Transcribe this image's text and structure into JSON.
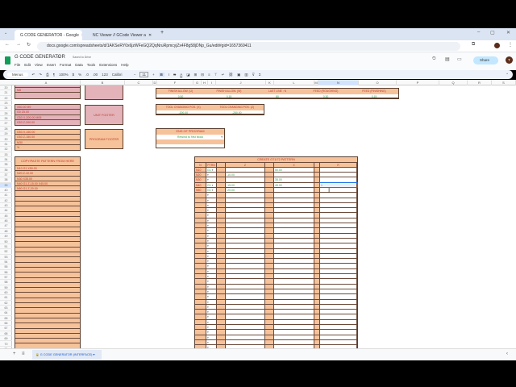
{
  "browser": {
    "tabs": [
      {
        "label": "G CODE GENERATOR - Google",
        "active": true
      },
      {
        "label": "NC Viewer // GCode Viewer a",
        "active": false
      }
    ],
    "new_tab": "+",
    "url": "docs.google.com/spreadsheets/d/1AKSeRY0x6jzWFeGQ2QqNruRpmcyjZx4F8g58jDNp_Gu/edit#gid=1657369411"
  },
  "sheets": {
    "title": "G CODE GENERATOR",
    "saved": "Saved to Drive",
    "menus": [
      "File",
      "Edit",
      "View",
      "Insert",
      "Format",
      "Data",
      "Tools",
      "Extensions",
      "Help"
    ],
    "share": "Share",
    "avatar": "T",
    "accent": "#c2e7ff"
  },
  "toolbar": {
    "menus": "Menus",
    "zoom": "100%",
    "currency": "$",
    "percent": "%",
    "dec_less": ".0",
    "dec_more": ".00",
    "format": "123",
    "font": "Calibri",
    "font_size": "11",
    "bold": "B",
    "italic": "I",
    "strike": "S",
    "text_color": "A"
  },
  "columns": [
    "A",
    "B",
    "C",
    "D",
    "E",
    "F",
    "G",
    "H",
    "I",
    "J",
    "K",
    "L",
    "M",
    "N",
    "O",
    "P",
    "Q",
    "R",
    "S"
  ],
  "rows": [
    20,
    21,
    22,
    23,
    24,
    25,
    26,
    27,
    28,
    29,
    30,
    31,
    32,
    33,
    34,
    35,
    36,
    37,
    38,
    39,
    40,
    41,
    42,
    43,
    44,
    45,
    46,
    47,
    48,
    49,
    50,
    51,
    52,
    53,
    54,
    55,
    56,
    57,
    58,
    59,
    60,
    61,
    62,
    63,
    64,
    65,
    66,
    67,
    68,
    69,
    70,
    71
  ],
  "blocks": {
    "unit_header_tail": [
      "",
      "M8",
      ""
    ],
    "unit_footer": {
      "lines": [
        "X50.00 M9",
        "G0 Z5.00",
        "G53 X-200.00 M05",
        "G53 Z-200.00"
      ],
      "label": "UNIT FOOTER"
    },
    "program_footer": {
      "lines": [
        "G53 X-150.00",
        "G53 Z-150.00",
        "M30",
        "%"
      ],
      "label": "PROGRAM FOOTER"
    },
    "copy_paste": {
      "header": "COPY/PASTE PATTERN FROM HERE",
      "lines": [
        "N10 G1 X50.00",
        "N20 Z-10.00",
        "N30 X35.00",
        "N40 G1 Z-15.00 X45.00",
        "N50 G1 Z-20.00"
      ]
    }
  },
  "params": {
    "headers": [
      "FINISH ALLOW. (U)",
      "FINISH ALLOW. (W)",
      "LAST LINE : N",
      "FEED (ROUGHING)",
      "FEED (FINISHING)"
    ],
    "values": [
      "0.50",
      "0.15",
      "80",
      "0.30",
      "0.15"
    ]
  },
  "tool_pos": {
    "headers": [
      "TOOL CHANGING POS. (X)",
      "TOOL CHANGING POS. (Z)"
    ],
    "values": [
      "-200.00",
      "-250.00"
    ]
  },
  "end_program": {
    "header": "END OF PROGRAM",
    "value": "Rewind to first block"
  },
  "pattern": {
    "title": "CREATE G71/72 PATTERN",
    "headers": [
      "N",
      "PTRN",
      "Z",
      "X",
      "R"
    ],
    "rows": [
      {
        "n": "N10",
        "g": "G1",
        "z": "",
        "x": "50.00",
        "r": ""
      },
      {
        "n": "N20",
        "g": "",
        "z": "-10.00",
        "x": "",
        "r": ""
      },
      {
        "n": "N30",
        "g": "",
        "z": "",
        "x": "35.00",
        "r": ""
      },
      {
        "n": "N40",
        "g": "G1",
        "z": "-15.00",
        "x": "45.00",
        "r": "1"
      },
      {
        "n": "N50",
        "g": "G1",
        "z": "-20.00",
        "x": "",
        "r": ""
      }
    ]
  },
  "sheet_tab": "G CODE GENERATOR (INTERFACE)"
}
